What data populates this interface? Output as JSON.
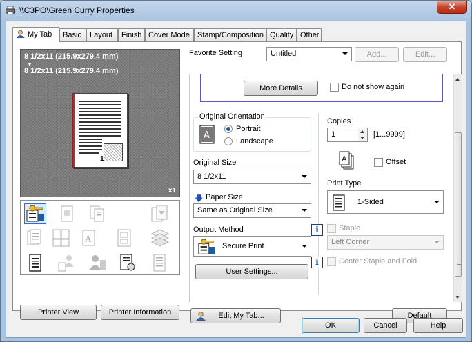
{
  "window": {
    "title": "\\\\C3PO\\Green Curry Properties",
    "close_glyph": "✕"
  },
  "tabs": [
    {
      "label": "My Tab",
      "active": true
    },
    {
      "label": "Basic"
    },
    {
      "label": "Layout"
    },
    {
      "label": "Finish"
    },
    {
      "label": "Cover Mode"
    },
    {
      "label": "Stamp/Composition"
    },
    {
      "label": "Quality"
    },
    {
      "label": "Other"
    }
  ],
  "preview": {
    "paper_size_line1": "8 1/2x11 (215.9x279.4 mm)",
    "paper_size_line2": "8 1/2x11 (215.9x279.4 mm)",
    "page_number": "1",
    "copies_indicator": "x1",
    "arrow": "▼"
  },
  "left_buttons": {
    "printer_view": "Printer View",
    "printer_information": "Printer Information"
  },
  "favorite": {
    "label": "Favorite Setting",
    "value": "Untitled",
    "add": "Add...",
    "edit": "Edit..."
  },
  "details": {
    "more_details": "More Details",
    "do_not_show": "Do not show again"
  },
  "orientation": {
    "group_label": "Original Orientation",
    "portrait": "Portrait",
    "landscape": "Landscape",
    "icon_letter": "A"
  },
  "original_size": {
    "label": "Original Size",
    "value": "8 1/2x11"
  },
  "paper_size": {
    "label": "Paper Size",
    "value": "Same as Original Size",
    "arrow": "🡇"
  },
  "output_method": {
    "label": "Output Method",
    "value": "Secure Print"
  },
  "user_settings": "User Settings...",
  "copies": {
    "label": "Copies",
    "value": "1",
    "range": "[1...9999]"
  },
  "offset": {
    "label": "Offset"
  },
  "print_type": {
    "label": "Print Type",
    "value": "1-Sided"
  },
  "staple": {
    "label": "Staple",
    "value": "Left Corner"
  },
  "center_staple": {
    "label": "Center Staple and Fold"
  },
  "info_glyph": "i",
  "bottom": {
    "edit_my_tab": "Edit My Tab...",
    "default": "Default"
  },
  "dialog_buttons": {
    "ok": "OK",
    "cancel": "Cancel",
    "help": "Help"
  }
}
